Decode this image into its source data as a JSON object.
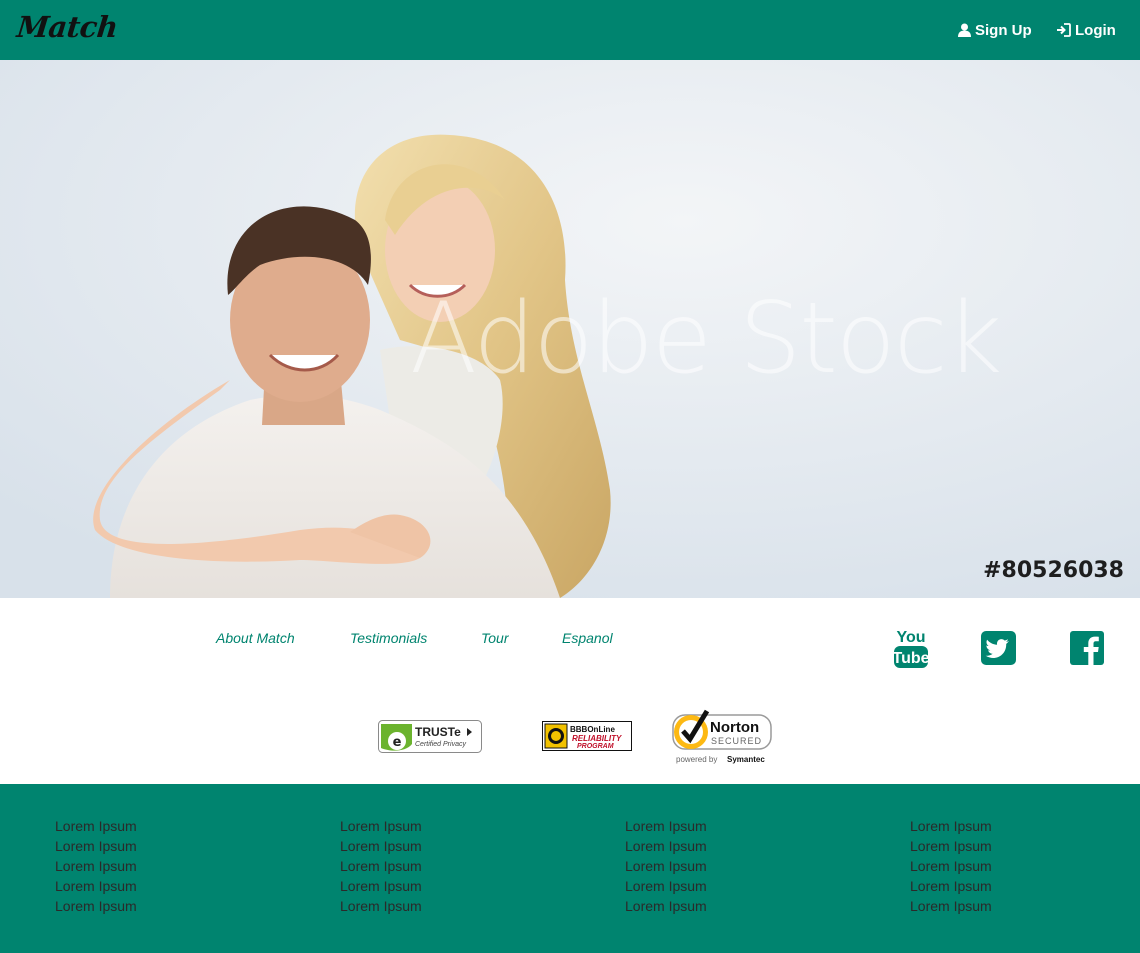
{
  "header": {
    "logo_text": "Match",
    "signup_label": "Sign Up",
    "login_label": "Login",
    "background_color": "#00846f"
  },
  "hero": {
    "watermark_text": "Adobe Stock",
    "stock_id": "#80526038"
  },
  "footer_links": {
    "items": [
      {
        "label": "About Match"
      },
      {
        "label": "Testimonials"
      },
      {
        "label": "Tour"
      },
      {
        "label": "Espanol"
      }
    ]
  },
  "social": {
    "youtube_top": "You",
    "youtube_bottom": "Tube",
    "icons": [
      "youtube-icon",
      "twitter-icon",
      "facebook-icon"
    ]
  },
  "badges": {
    "truste_title": "TRUSTe",
    "truste_sub": "Certified Privacy",
    "bbb_line1": "BBBOnLine",
    "bbb_line2": "RELIABILITY",
    "bbb_line3": "PROGRAM",
    "norton_title": "Norton",
    "norton_secured": "SECURED",
    "norton_powered": "powered by",
    "norton_brand": "Symantec"
  },
  "bottom_footer": {
    "columns": [
      {
        "items": [
          "Lorem Ipsum",
          "Lorem Ipsum",
          "Lorem Ipsum",
          "Lorem Ipsum",
          "Lorem Ipsum"
        ]
      },
      {
        "items": [
          "Lorem Ipsum",
          "Lorem Ipsum",
          "Lorem Ipsum",
          "Lorem Ipsum",
          "Lorem Ipsum"
        ]
      },
      {
        "items": [
          "Lorem Ipsum",
          "Lorem Ipsum",
          "Lorem Ipsum",
          "Lorem Ipsum",
          "Lorem Ipsum"
        ]
      },
      {
        "items": [
          "Lorem Ipsum",
          "Lorem Ipsum",
          "Lorem Ipsum",
          "Lorem Ipsum",
          "Lorem Ipsum"
        ]
      }
    ]
  }
}
